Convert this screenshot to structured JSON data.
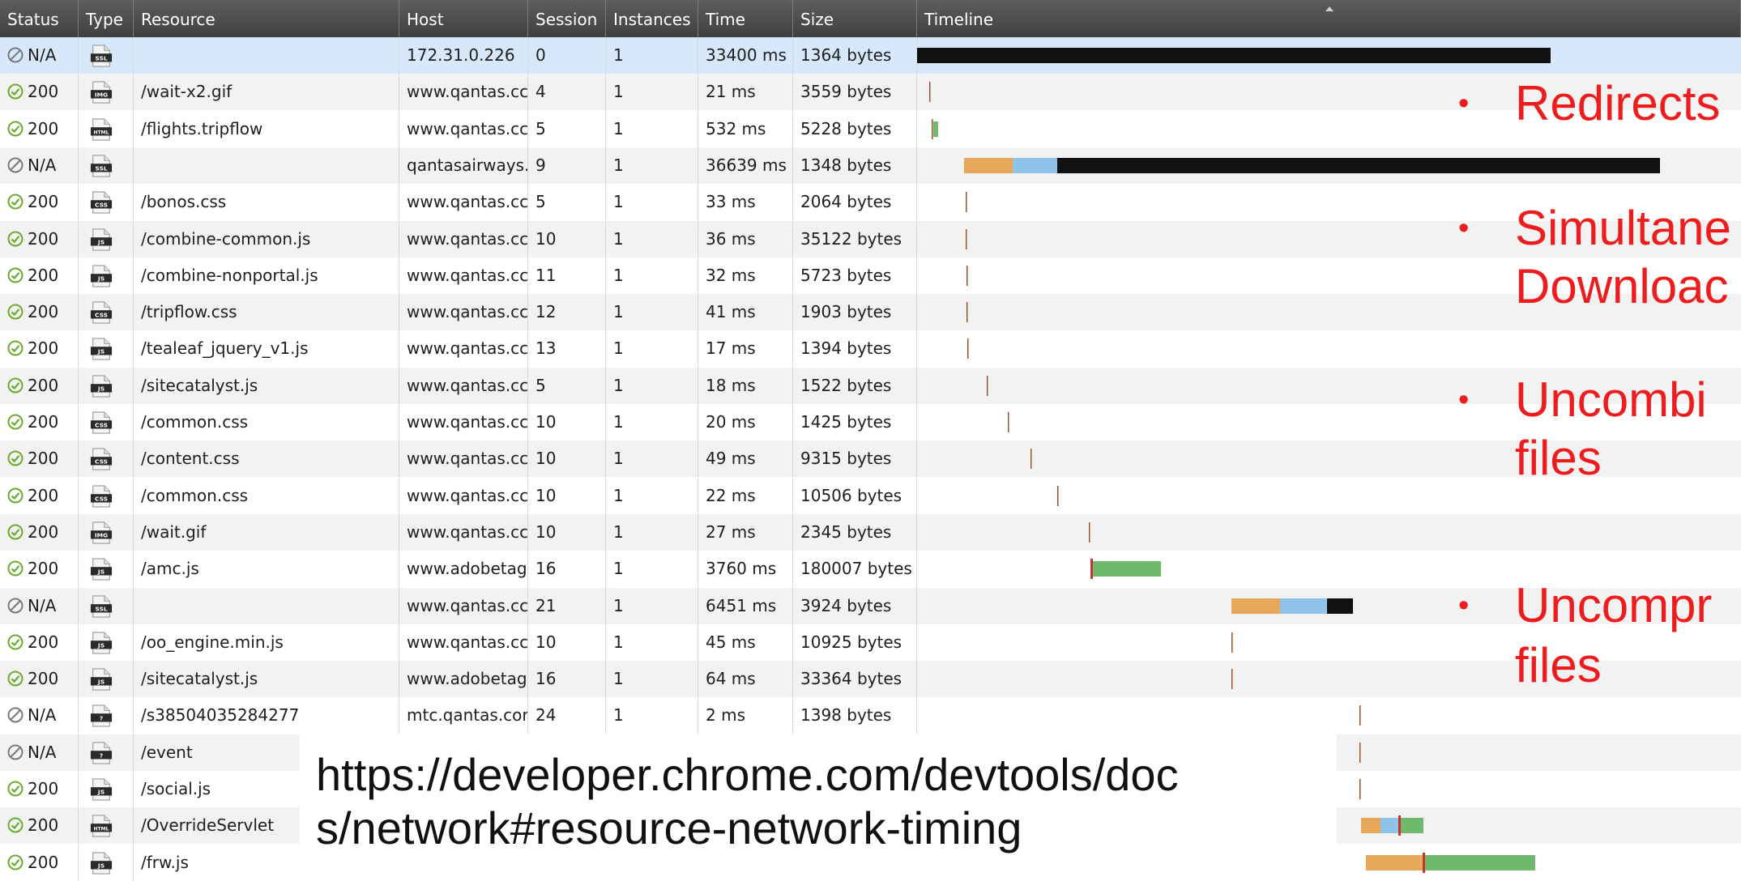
{
  "columns": [
    "Status",
    "Type",
    "Resource",
    "Host",
    "Session",
    "Instances",
    "Time",
    "Size",
    "Timeline"
  ],
  "rows": [
    {
      "status": "N/A",
      "status_kind": "na",
      "type": "SSL",
      "resource": "",
      "host": "172.31.0.226",
      "session": "0",
      "instances": "1",
      "time": "33400 ms",
      "size": "1364 bytes"
    },
    {
      "status": "200",
      "status_kind": "ok",
      "type": "IMG",
      "resource": "/wait-x2.gif",
      "host": "www.qantas.cc",
      "session": "4",
      "instances": "1",
      "time": "21 ms",
      "size": "3559 bytes"
    },
    {
      "status": "200",
      "status_kind": "ok",
      "type": "HTML",
      "resource": "/flights.tripflow",
      "host": "www.qantas.cc",
      "session": "5",
      "instances": "1",
      "time": "532 ms",
      "size": "5228 bytes"
    },
    {
      "status": "N/A",
      "status_kind": "na",
      "type": "SSL",
      "resource": "",
      "host": "qantasairways.",
      "session": "9",
      "instances": "1",
      "time": "36639 ms",
      "size": "1348 bytes"
    },
    {
      "status": "200",
      "status_kind": "ok",
      "type": "CSS",
      "resource": "/bonos.css",
      "host": "www.qantas.cc",
      "session": "5",
      "instances": "1",
      "time": "33 ms",
      "size": "2064 bytes"
    },
    {
      "status": "200",
      "status_kind": "ok",
      "type": "JS",
      "resource": "/combine-common.js",
      "host": "www.qantas.cc",
      "session": "10",
      "instances": "1",
      "time": "36 ms",
      "size": "35122 bytes"
    },
    {
      "status": "200",
      "status_kind": "ok",
      "type": "JS",
      "resource": "/combine-nonportal.js",
      "host": "www.qantas.cc",
      "session": "11",
      "instances": "1",
      "time": "32 ms",
      "size": "5723 bytes"
    },
    {
      "status": "200",
      "status_kind": "ok",
      "type": "CSS",
      "resource": "/tripflow.css",
      "host": "www.qantas.cc",
      "session": "12",
      "instances": "1",
      "time": "41 ms",
      "size": "1903 bytes"
    },
    {
      "status": "200",
      "status_kind": "ok",
      "type": "JS",
      "resource": "/tealeaf_jquery_v1.js",
      "host": "www.qantas.cc",
      "session": "13",
      "instances": "1",
      "time": "17 ms",
      "size": "1394 bytes"
    },
    {
      "status": "200",
      "status_kind": "ok",
      "type": "JS",
      "resource": "/sitecatalyst.js",
      "host": "www.qantas.cc",
      "session": "5",
      "instances": "1",
      "time": "18 ms",
      "size": "1522 bytes"
    },
    {
      "status": "200",
      "status_kind": "ok",
      "type": "CSS",
      "resource": "/common.css",
      "host": "www.qantas.cc",
      "session": "10",
      "instances": "1",
      "time": "20 ms",
      "size": "1425 bytes"
    },
    {
      "status": "200",
      "status_kind": "ok",
      "type": "CSS",
      "resource": "/content.css",
      "host": "www.qantas.cc",
      "session": "10",
      "instances": "1",
      "time": "49 ms",
      "size": "9315 bytes"
    },
    {
      "status": "200",
      "status_kind": "ok",
      "type": "CSS",
      "resource": "/common.css",
      "host": "www.qantas.cc",
      "session": "10",
      "instances": "1",
      "time": "22 ms",
      "size": "10506 bytes"
    },
    {
      "status": "200",
      "status_kind": "ok",
      "type": "IMG",
      "resource": "/wait.gif",
      "host": "www.qantas.cc",
      "session": "10",
      "instances": "1",
      "time": "27 ms",
      "size": "2345 bytes"
    },
    {
      "status": "200",
      "status_kind": "ok",
      "type": "JS",
      "resource": "/amc.js",
      "host": "www.adobetag",
      "session": "16",
      "instances": "1",
      "time": "3760 ms",
      "size": "180007 bytes"
    },
    {
      "status": "N/A",
      "status_kind": "na",
      "type": "SSL",
      "resource": "",
      "host": "www.qantas.cc",
      "session": "21",
      "instances": "1",
      "time": "6451 ms",
      "size": "3924 bytes"
    },
    {
      "status": "200",
      "status_kind": "ok",
      "type": "JS",
      "resource": "/oo_engine.min.js",
      "host": "www.qantas.cc",
      "session": "10",
      "instances": "1",
      "time": "45 ms",
      "size": "10925 bytes"
    },
    {
      "status": "200",
      "status_kind": "ok",
      "type": "JS",
      "resource": "/sitecatalyst.js",
      "host": "www.adobetag",
      "session": "16",
      "instances": "1",
      "time": "64 ms",
      "size": "33364 bytes"
    },
    {
      "status": "N/A",
      "status_kind": "na",
      "type": "?",
      "resource": "/s38504035284277",
      "host": "mtc.qantas.cor",
      "session": "24",
      "instances": "1",
      "time": "2 ms",
      "size": "1398 bytes"
    },
    {
      "status": "N/A",
      "status_kind": "na",
      "type": "?",
      "resource": "/event",
      "host": "",
      "session": "",
      "instances": "",
      "time": "",
      "size": ""
    },
    {
      "status": "200",
      "status_kind": "ok",
      "type": "JS",
      "resource": "/social.js",
      "host": "",
      "session": "",
      "instances": "",
      "time": "",
      "size": ""
    },
    {
      "status": "200",
      "status_kind": "ok",
      "type": "HTML",
      "resource": "/OverrideServlet",
      "host": "",
      "session": "",
      "instances": "",
      "time": "",
      "size": ""
    },
    {
      "status": "200",
      "status_kind": "ok",
      "type": "JS",
      "resource": "/frw.js",
      "host": "",
      "session": "",
      "instances": "",
      "time": "",
      "size": ""
    }
  ],
  "bullets": [
    {
      "lines": [
        "Redirects"
      ]
    },
    {
      "lines": [
        "Simultane",
        "Downloac"
      ]
    },
    {
      "lines": [
        "Uncombi",
        "files"
      ]
    },
    {
      "lines": [
        "Uncompr",
        "files"
      ]
    }
  ],
  "url_lines": [
    "https://developer.chrome.com/devtools/doc",
    "s/network#resource-network-timing"
  ],
  "colors": {
    "header_bg": "#4a4a4a",
    "selected_row": "#d8e8fb",
    "ok_icon": "#6aab2e",
    "na_icon": "#7a7a7a",
    "timeline_dns": "#e8a85c",
    "timeline_connect": "#8fc3ea",
    "timeline_ssl": "#111111",
    "timeline_receive": "#6fba6a",
    "timeline_tick": "#c8342f",
    "annotation": "#ee1c1c"
  },
  "icon_names": {
    "ok": "check-circle-icon",
    "na": "blocked-circle-icon",
    "type": "file-type-icon"
  }
}
